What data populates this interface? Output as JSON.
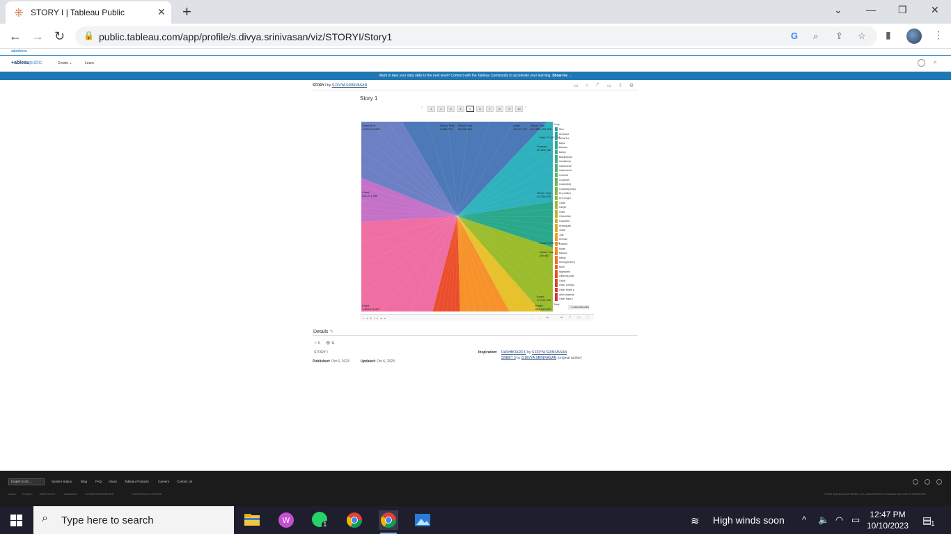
{
  "browser": {
    "tab_title": "STORY I | Tableau Public",
    "url": "public.tableau.com/app/profile/s.divya.srinivasan/viz/STORYI/Story1"
  },
  "tableau_nav": {
    "brand": "salesforce",
    "logo_main": "+ableau",
    "logo_sub": "public",
    "create": "Create ⌄",
    "learn": "Learn"
  },
  "banner": {
    "text": "Want to take your data skills to the next level? Connect with the Tableau Community to accelerate your learning.",
    "cta": "Show me →"
  },
  "viz_header": {
    "title": "STORY I",
    "by": "by",
    "author": "S.DIVYA SRINIVASAN"
  },
  "story": {
    "title": "Story 1",
    "points": [
      "1",
      "2",
      "3",
      "4",
      "5",
      "6",
      "7",
      "8",
      "9",
      "10"
    ],
    "active_point": "5"
  },
  "chart_data": {
    "type": "pie",
    "legend_title": "Crop",
    "legend": [
      {
        "name": "Rice",
        "color": "#2e9aa6"
      },
      {
        "name": "Arecanut",
        "color": "#2ba39f"
      },
      {
        "name": "Arhar/Tur",
        "color": "#2fa49a"
      },
      {
        "name": "Bajra",
        "color": "#33a694"
      },
      {
        "name": "Banana",
        "color": "#37a88e"
      },
      {
        "name": "Barley",
        "color": "#3baa88"
      },
      {
        "name": "Blackpepper",
        "color": "#3fac82"
      },
      {
        "name": "Cardamom",
        "color": "#43ad7b"
      },
      {
        "name": "Cashewnut",
        "color": "#49af74"
      },
      {
        "name": "Castorseed",
        "color": "#52b06b"
      },
      {
        "name": "Coconut",
        "color": "#5cb263"
      },
      {
        "name": "Coriander",
        "color": "#66b35b"
      },
      {
        "name": "Cotton(lint)",
        "color": "#71b453"
      },
      {
        "name": "Cowpea(Lobia)",
        "color": "#7cb54b"
      },
      {
        "name": "Dry chillies",
        "color": "#87b644"
      },
      {
        "name": "Dry Ginger",
        "color": "#93b73d"
      },
      {
        "name": "Garlic",
        "color": "#9fb737"
      },
      {
        "name": "Ginger",
        "color": "#abb732"
      },
      {
        "name": "Gram",
        "color": "#b7b62d"
      },
      {
        "name": "Groundnut",
        "color": "#c3b42a"
      },
      {
        "name": "Guarseed",
        "color": "#cfb128"
      },
      {
        "name": "Horsegram",
        "color": "#dbad27"
      },
      {
        "name": "Jowar",
        "color": "#e6a726"
      },
      {
        "name": "Jute",
        "color": "#f0a026"
      },
      {
        "name": "Khesari",
        "color": "#f69826"
      },
      {
        "name": "Linseed",
        "color": "#f98f25"
      },
      {
        "name": "Maize",
        "color": "#fa8524"
      },
      {
        "name": "Masoor",
        "color": "#f97b23"
      },
      {
        "name": "Mesta",
        "color": "#f77122"
      },
      {
        "name": "Moong(Green)",
        "color": "#f46721"
      },
      {
        "name": "Moth",
        "color": "#f05d20"
      },
      {
        "name": "Nigerseed",
        "color": "#ec531f"
      },
      {
        "name": "Oilseeds total",
        "color": "#e84a21"
      },
      {
        "name": "Onion",
        "color": "#e54226"
      },
      {
        "name": "Other Cereals",
        "color": "#e23b2d"
      },
      {
        "name": "Other Kharif p",
        "color": "#df3536"
      },
      {
        "name": "other oilseeds",
        "color": "#dc3140"
      },
      {
        "name": "Other Rabi p",
        "color": "#d92e4b"
      }
    ],
    "legend_total_label": "Total",
    "legend_total_value": "4,082,800,828",
    "slices": [
      {
        "color": "#4e79b8",
        "share": 0.205
      },
      {
        "color": "#2fb2bd",
        "share": 0.105
      },
      {
        "color": "#29a88b",
        "share": 0.075
      },
      {
        "color": "#9bbc2d",
        "share": 0.085
      },
      {
        "color": "#e7c12a",
        "share": 0.035
      },
      {
        "color": "#f7922a",
        "share": 0.075
      },
      {
        "color": "#eb4e2c",
        "share": 0.045
      },
      {
        "color": "#ef6fa4",
        "share": 0.2
      },
      {
        "color": "#c471c8",
        "share": 0.07
      },
      {
        "color": "#6d80c4",
        "share": 0.105
      }
    ],
    "labels": [
      {
        "text": "Kharif Rice 1,649,413,969"
      },
      {
        "text": "Whole Year 5,684,293"
      },
      {
        "text": "Whole Year 35,402,819"
      },
      {
        "text": "Kharif 40,193,779"
      },
      {
        "text": "Whole Year 510,534,293,305"
      },
      {
        "text": "Rabi 27,493,878"
      },
      {
        "text": "Summer 40,124,782"
      },
      {
        "text": "Kharif 202,271,636"
      },
      {
        "text": "Whole Year 20,330,679"
      },
      {
        "text": "Kharif 5,674,809"
      },
      {
        "text": "Whole Year 409,967"
      },
      {
        "text": "Kharif 70,792,349"
      },
      {
        "text": "Kharif 1,383,610,337"
      },
      {
        "text": "Kharif 283,040,651"
      }
    ]
  },
  "viz_footer": {
    "brand": "+ a b l e a u"
  },
  "details": {
    "heading": "Details",
    "favorites": "5",
    "views": "11",
    "description": "STORY I",
    "published_label": "Published:",
    "published": "Oct 6, 2023",
    "updated_label": "Updated:",
    "updated": "Oct 6, 2023",
    "inspiration_label": "Inspiration:",
    "insp1_title": "DASHBOARD II",
    "insp1_by": "by",
    "insp1_author": "S.DIVYA SRINIVASAN",
    "insp2_title": "SHEET 3",
    "insp2_by": "by",
    "insp2_author": "S.DIVYA SRINIVASAN",
    "insp2_note": "(original author)"
  },
  "footer": {
    "language": "English (US)",
    "links": [
      "System Status",
      "Blog",
      "FAQ",
      "About",
      "Tableau Products",
      "Careers",
      "Contact Us"
    ],
    "legal": [
      "LEGAL",
      "PRIVACY",
      "DATA POLICY",
      "UNINSTALL",
      "COOKIE PREFERENCES",
      "YOUR PRIVACY CHOICES"
    ],
    "copyright": "© 2023 TABLEAU SOFTWARE, LLC, A SALESFORCE COMPANY. ALL RIGHTS RESERVED."
  },
  "taskbar": {
    "search_placeholder": "Type here to search",
    "weather": "High winds soon",
    "time": "12:47 PM",
    "date": "10/10/2023",
    "notification_count": "1",
    "whatsapp_badge": "1"
  }
}
